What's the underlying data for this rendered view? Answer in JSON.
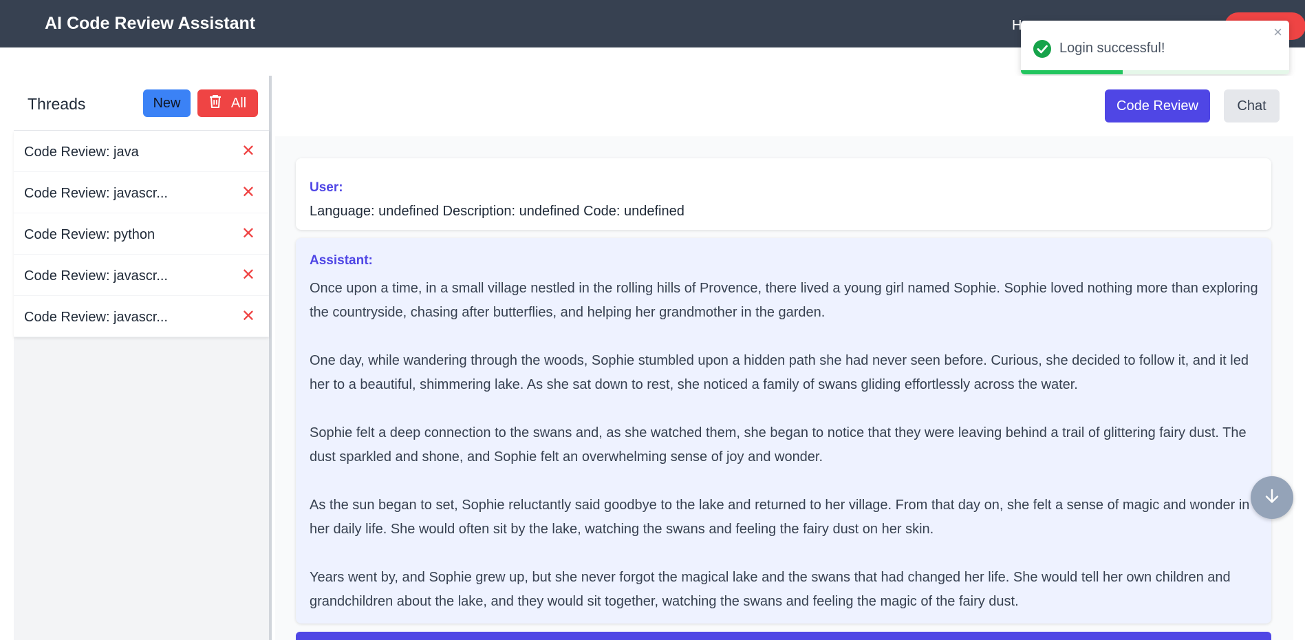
{
  "header": {
    "title": "AI Code Review Assistant",
    "nav_partial": "H"
  },
  "toast": {
    "message": "Login successful!",
    "close": "×",
    "progress": 0.38
  },
  "sidebar": {
    "title": "Threads",
    "new_label": "New",
    "delete_all_label": "All",
    "threads": [
      {
        "label": "Code Review: java"
      },
      {
        "label": "Code Review: javascr..."
      },
      {
        "label": "Code Review: python"
      },
      {
        "label": "Code Review: javascr..."
      },
      {
        "label": "Code Review: javascr..."
      }
    ],
    "remove_glyph": "✕"
  },
  "tabs": {
    "code_review": "Code Review",
    "chat": "Chat",
    "active": "Code Review"
  },
  "messages": {
    "user": {
      "role": "User:",
      "text": "Language: undefined Description: undefined Code: undefined"
    },
    "assistant": {
      "role": "Assistant:",
      "paragraphs": [
        "Once upon a time, in a small village nestled in the rolling hills of Provence, there lived a young girl named Sophie. Sophie loved nothing more than exploring the countryside, chasing after butterflies, and helping her grandmother in the garden.",
        "One day, while wandering through the woods, Sophie stumbled upon a hidden path she had never seen before. Curious, she decided to follow it, and it led her to a beautiful, shimmering lake. As she sat down to rest, she noticed a family of swans gliding effortlessly across the water.",
        "Sophie felt a deep connection to the swans and, as she watched them, she began to notice that they were leaving behind a trail of glittering fairy dust. The dust sparkled and shone, and Sophie felt an overwhelming sense of joy and wonder.",
        "As the sun began to set, Sophie reluctantly said goodbye to the lake and returned to her village. From that day on, she felt a sense of magic and wonder in her daily life. She would often sit by the lake, watching the swans and feeling the fairy dust on her skin.",
        "Years went by, and Sophie grew up, but she never forgot the magical lake and the swans that had changed her life. She would tell her own children and grandchildren about the lake, and they would sit together, watching the swans and feeling the magic of the fairy dust."
      ]
    }
  },
  "colors": {
    "header_bg": "#374151",
    "primary": "#4f46e5",
    "new_button": "#3b82f6",
    "danger": "#ef4444",
    "success": "#22c55e",
    "assistant_bg": "#eef2ff"
  },
  "icons": {
    "toast_status": "check-circle-icon",
    "delete_all": "trash-icon",
    "thread_remove": "x-icon",
    "scroll": "arrow-down-icon"
  }
}
